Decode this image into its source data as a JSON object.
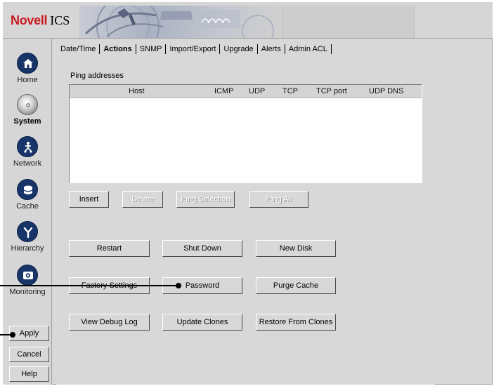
{
  "header": {
    "brand": "Novell",
    "product": "ICS"
  },
  "sidebar": {
    "items": [
      {
        "label": "Home",
        "icon": "home-icon"
      },
      {
        "label": "System",
        "icon": "system-disc-icon",
        "active": true
      },
      {
        "label": "Network",
        "icon": "network-icon"
      },
      {
        "label": "Cache",
        "icon": "cache-disk-icon"
      },
      {
        "label": "Hierarchy",
        "icon": "hierarchy-icon"
      },
      {
        "label": "Monitoring",
        "icon": "monitoring-icon"
      }
    ],
    "buttons": {
      "apply": "Apply",
      "cancel": "Cancel",
      "help": "Help"
    }
  },
  "tabs": [
    {
      "label": "Date/Time"
    },
    {
      "label": "Actions",
      "active": true
    },
    {
      "label": "SNMP"
    },
    {
      "label": "Import/Export"
    },
    {
      "label": "Upgrade"
    },
    {
      "label": "Alerts"
    },
    {
      "label": "Admin ACL"
    }
  ],
  "ping": {
    "title": "Ping addresses",
    "columns": [
      "Host",
      "ICMP",
      "UDP",
      "TCP",
      "TCP port",
      "UDP DNS"
    ],
    "rows": []
  },
  "ping_buttons": {
    "insert": "Insert",
    "delete": "Delete",
    "ping_selection": "Ping Selection",
    "ping_all": "Ping All"
  },
  "actions": {
    "restart": "Restart",
    "shut_down": "Shut Down",
    "new_disk": "New Disk",
    "factory_settings": "Factory Settings",
    "password": "Password",
    "purge_cache": "Purge Cache",
    "view_debug_log": "View Debug Log",
    "update_clones": "Update Clones",
    "restore_from_clones": "Restore From Clones"
  },
  "colors": {
    "brand_red": "#c8191e",
    "icon_navy": "#18356a",
    "panel_gray": "#d8d8d8"
  }
}
